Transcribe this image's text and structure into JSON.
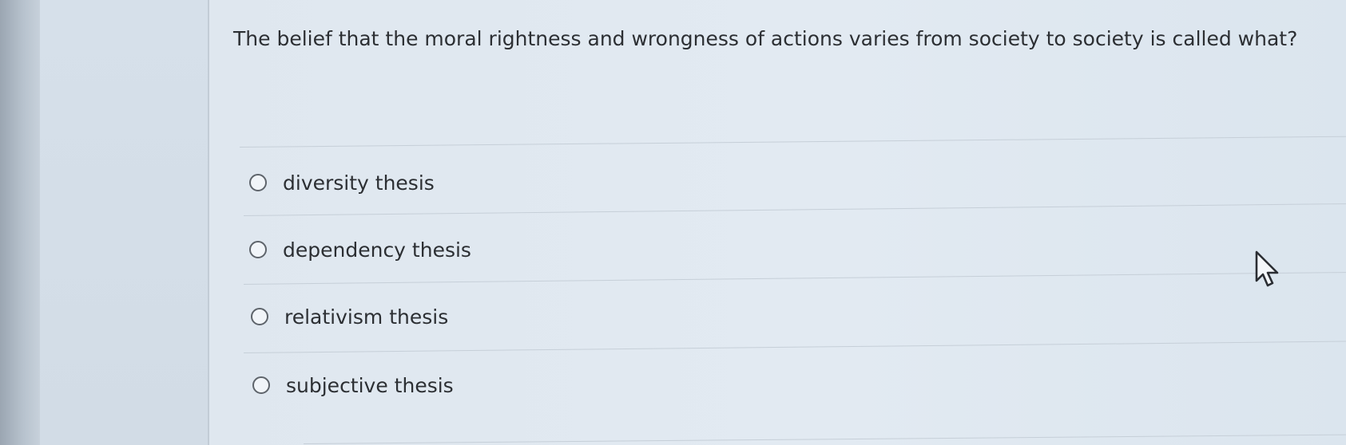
{
  "question": {
    "text": "The belief that the moral rightness and wrongness of actions varies from society to society is called what?"
  },
  "options": [
    {
      "label": "diversity thesis",
      "selected": false
    },
    {
      "label": "dependency thesis",
      "selected": false
    },
    {
      "label": "relativism thesis",
      "selected": false
    },
    {
      "label": "subjective thesis",
      "selected": false
    }
  ],
  "cursor": {
    "icon": "mouse-pointer-icon"
  },
  "colors": {
    "text": "#2c2f33",
    "background": "#e0e8f0",
    "radio_border": "#5e646b"
  }
}
